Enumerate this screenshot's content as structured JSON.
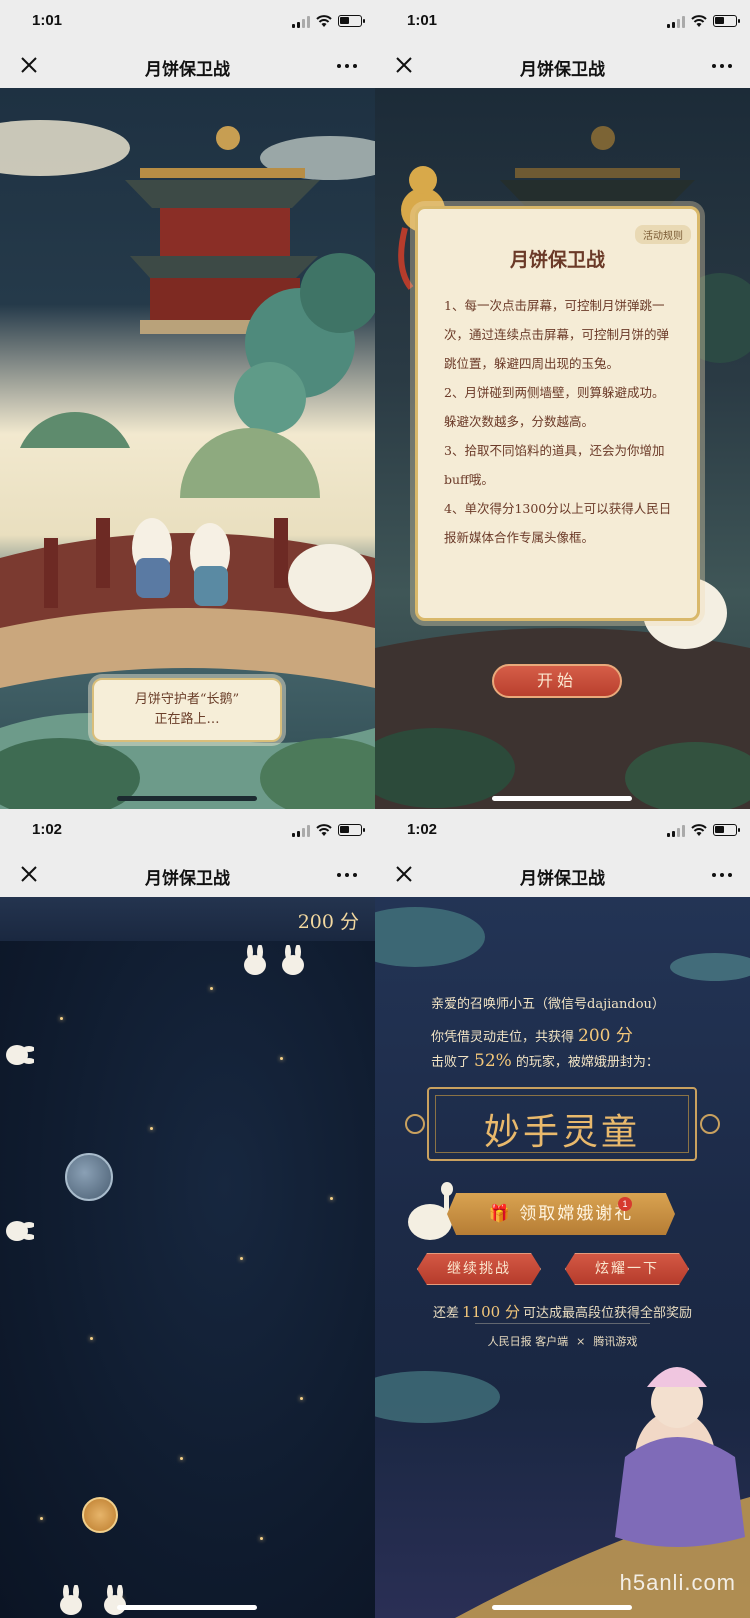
{
  "panels": [
    {
      "time": "1:01",
      "nav_title": "月饼保卫战",
      "loading_line1": "月饼守护者“长鹅”",
      "loading_line2": "正在路上…"
    },
    {
      "time": "1:01",
      "nav_title": "月饼保卫战",
      "rules_tag": "活动规则",
      "rules_title": "月饼保卫战",
      "rules": [
        "1、每一次点击屏幕，可控制月饼弹跳一次，通过连续点击屏幕，可控制月饼的弹跳位置，躲避四周出现的玉兔。",
        "2、月饼碰到两侧墙壁，则算躲避成功。躲避次数越多，分数越高。",
        "3、拾取不同馅料的道具，还会为你增加buff哦。",
        "4、单次得分1300分以上可以获得人民日报新媒体合作专属头像框。"
      ],
      "start_label": "开始"
    },
    {
      "time": "1:02",
      "nav_title": "月饼保卫战",
      "score": "200 分"
    },
    {
      "time": "1:02",
      "nav_title": "月饼保卫战",
      "line1": "亲爱的召唤师小五（微信号dajiandou）",
      "line2_pre": "你凭借灵动走位，共获得",
      "line2_score": "200 分",
      "line3_pre": "击败了",
      "line3_pct": "52%",
      "line3_post": "的玩家，被嫦娥册封为：",
      "title": "妙手灵童",
      "gift_label": "领取嫦娥谢礼",
      "gift_badge": "1",
      "continue_label": "继续挑战",
      "share_label": "炫耀一下",
      "remain_pre": "还差",
      "remain_value": "1100 分",
      "remain_post": "可达成最高段位获得全部奖励",
      "partner_a": "人民日报 客户端",
      "partner_x": "×",
      "partner_b": "腾讯游戏",
      "watermark": "h5anli.com"
    }
  ],
  "colors": {
    "accent_gold": "#d9b86a",
    "button_red": "#c84a36",
    "night_blue": "#0f1b2e"
  },
  "icons": [
    "close-icon",
    "more-icon",
    "signal-icon",
    "wifi-icon",
    "battery-icon",
    "gift-icon"
  ]
}
